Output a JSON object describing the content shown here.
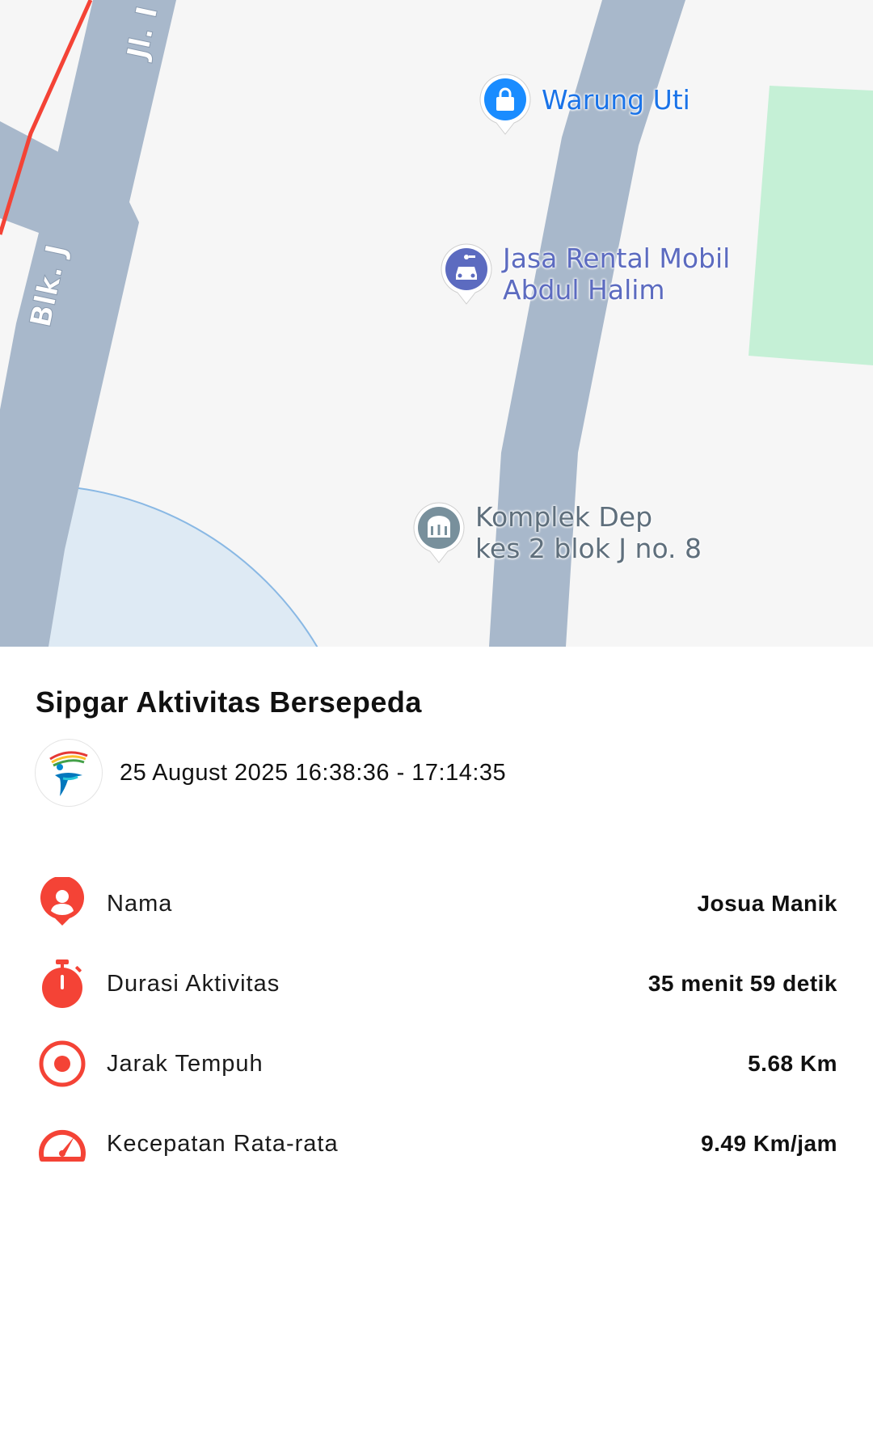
{
  "map": {
    "roads": [
      {
        "name": "Blk. J"
      },
      {
        "name": "Jl. I"
      }
    ],
    "places": [
      {
        "name_lines": [
          "Warung Uti"
        ],
        "icon": "shopping-bag-icon",
        "color": "#1a8cff"
      },
      {
        "name_lines": [
          "Jasa Rental Mobil",
          "Abdul Halim"
        ],
        "icon": "car-rental-icon",
        "color": "#5c6bc0"
      },
      {
        "name_lines": [
          "Komplek Dep",
          "kes 2 blok J no. 8"
        ],
        "icon": "building-icon",
        "color": "#78909c"
      }
    ],
    "colors": {
      "route": "#f44336",
      "road": "#a8b8cb",
      "park": "#c5f0d6",
      "accuracy_circle": "#b3d4f2"
    }
  },
  "panel": {
    "title": "Sipgar Aktivitas Bersepeda",
    "date_range": "25 August 2025 16:38:36 - 17:14:35",
    "stats": [
      {
        "icon": "user-location-icon",
        "label": "Nama",
        "value": "Josua Manik"
      },
      {
        "icon": "stopwatch-icon",
        "label": "Durasi Aktivitas",
        "value": "35 menit 59 detik"
      },
      {
        "icon": "target-icon",
        "label": "Jarak Tempuh",
        "value": "5.68 Km"
      },
      {
        "icon": "speedometer-icon",
        "label": "Kecepatan Rata-rata",
        "value": "9.49 Km/jam"
      }
    ],
    "accent_color": "#f44336"
  }
}
